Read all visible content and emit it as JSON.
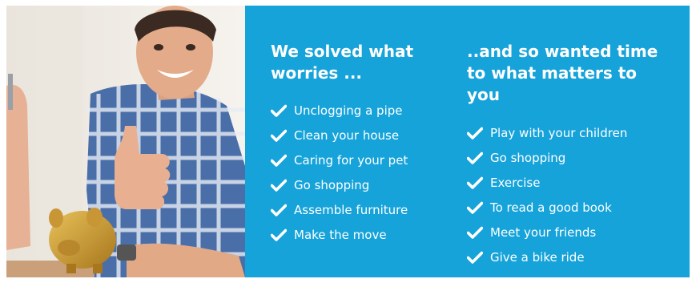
{
  "left_column": {
    "heading_line1": "We solved what",
    "heading_line2": "worries ...",
    "items": [
      "Unclogging a pipe",
      "Clean your house",
      "Caring for your pet",
      "Go shopping",
      "Assemble furniture",
      "Make the move"
    ]
  },
  "right_column": {
    "heading_line1": "..and so wanted time",
    "heading_line2": "to what matters to",
    "heading_line3": "you",
    "items": [
      "Play with your children",
      "Go shopping",
      "Exercise",
      "To read a good book",
      "Meet your friends",
      "Give a bike ride"
    ]
  },
  "colors": {
    "panel": "#16a3da",
    "text": "#ffffff"
  },
  "icons": {
    "check": "checkmark-icon"
  }
}
